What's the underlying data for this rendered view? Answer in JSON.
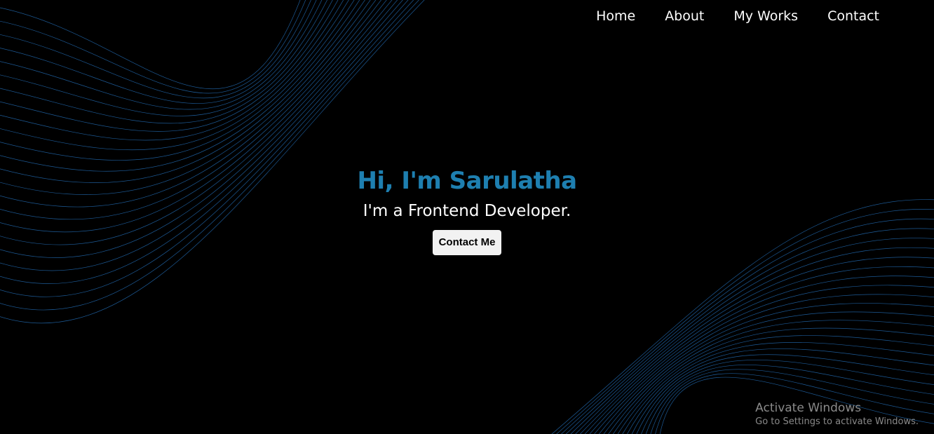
{
  "nav": {
    "items": [
      {
        "label": "Home"
      },
      {
        "label": "About"
      },
      {
        "label": "My Works"
      },
      {
        "label": "Contact"
      }
    ]
  },
  "hero": {
    "title": "Hi, I'm Sarulatha",
    "subtitle": "I'm a Frontend Developer.",
    "button_label": "Contact Me"
  },
  "watermark": {
    "title": "Activate Windows",
    "subtitle": "Go to Settings to activate Windows."
  },
  "colors": {
    "background": "#000000",
    "accent": "#1e7fb0",
    "wave": "#1f5f9e",
    "text": "#ffffff"
  }
}
